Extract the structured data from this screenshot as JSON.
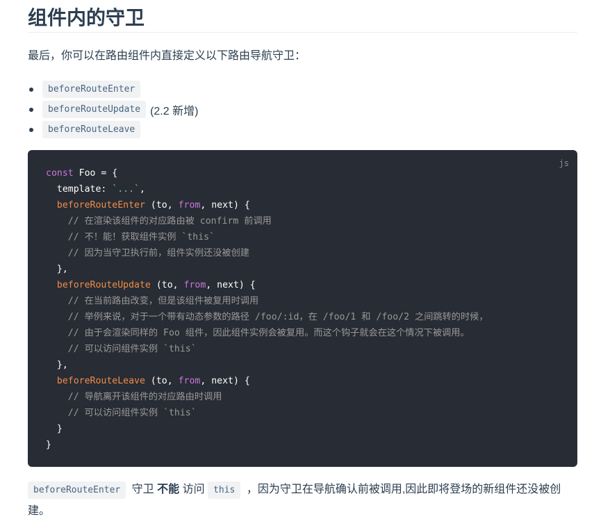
{
  "heading": "组件内的守卫",
  "intro": "最后，你可以在路由组件内直接定义以下路由导航守卫：",
  "hooks": [
    {
      "code": "beforeRouteEnter",
      "note": ""
    },
    {
      "code": "beforeRouteUpdate",
      "note": "(2.2 新增)"
    },
    {
      "code": "beforeRouteLeave",
      "note": ""
    }
  ],
  "code": {
    "lang": "js",
    "lines": {
      "l1_kw": "const",
      "l1_rest": " Foo = {",
      "l2_prop": "  template: ",
      "l2_str": "`...`",
      "l2_end": ",",
      "l3_fn": "beforeRouteEnter",
      "l3_rest_a": " (to, ",
      "l3_from": "from",
      "l3_rest_b": ", next) {",
      "l4": "    // 在渲染该组件的对应路由被 confirm 前调用",
      "l5": "    // 不！能！获取组件实例 `this`",
      "l6": "    // 因为当守卫执行前，组件实例还没被创建",
      "l7": "  },",
      "l8_fn": "beforeRouteUpdate",
      "l8_rest_a": " (to, ",
      "l8_from": "from",
      "l8_rest_b": ", next) {",
      "l9": "    // 在当前路由改变，但是该组件被复用时调用",
      "l10": "    // 举例来说，对于一个带有动态参数的路径 /foo/:id，在 /foo/1 和 /foo/2 之间跳转的时候，",
      "l11": "    // 由于会渲染同样的 Foo 组件，因此组件实例会被复用。而这个钩子就会在这个情况下被调用。",
      "l12": "    // 可以访问组件实例 `this`",
      "l13": "  },",
      "l14_fn": "beforeRouteLeave",
      "l14_rest_a": " (to, ",
      "l14_from": "from",
      "l14_rest_b": ", next) {",
      "l15": "    // 导航离开该组件的对应路由时调用",
      "l16": "    // 可以访问组件实例 `this`",
      "l17": "  }",
      "l18": "}"
    }
  },
  "bottom": {
    "code1": "beforeRouteEnter",
    "text1": " 守卫 ",
    "strong": "不能",
    "text2": " 访问 ",
    "code2": "this",
    "text3": " ，因为守卫在导航确认前被调用,因此即将登场的新组件还没被创建。"
  },
  "colors": {
    "text": "#2c3e50",
    "code_bg": "#282c34",
    "keyword": "#c678dd",
    "function": "#f08d49",
    "comment": "#999999",
    "string": "#7ec699",
    "inline_code": "#476582"
  }
}
